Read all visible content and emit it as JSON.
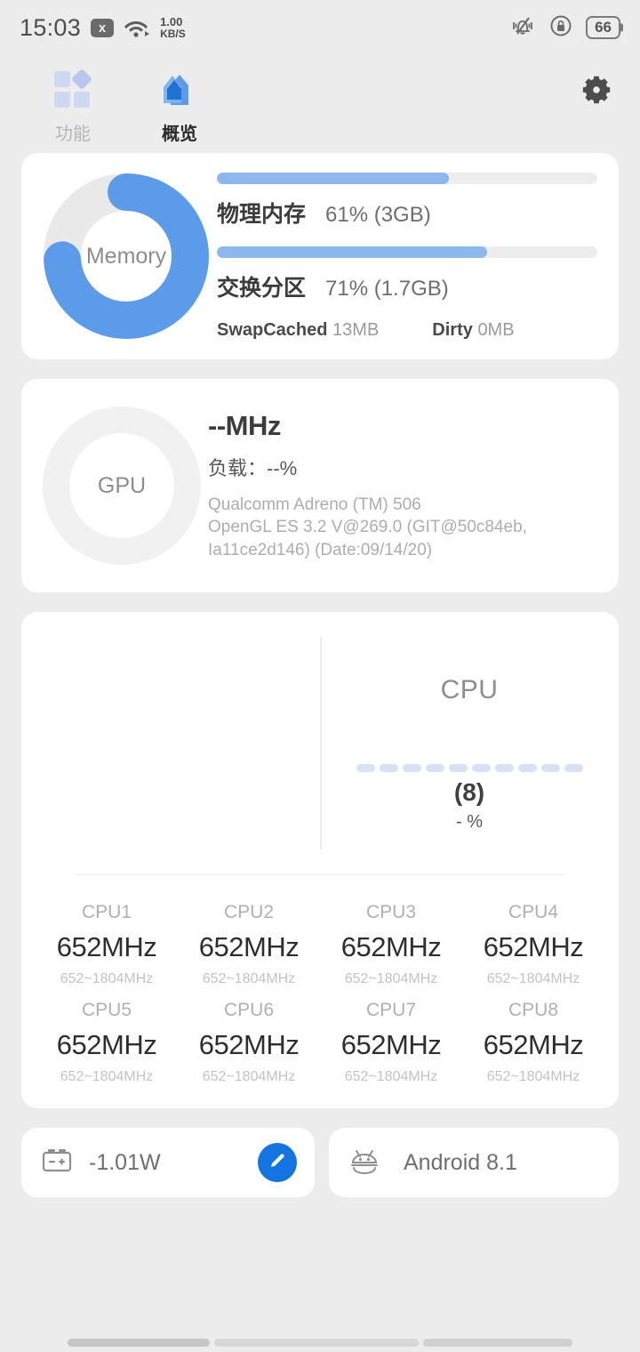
{
  "statusbar": {
    "time": "15:03",
    "xbox_badge": "x",
    "net_speed_value": "1.00",
    "net_speed_unit": "KB/S",
    "battery_percent": "66",
    "icons": [
      "wifi-icon",
      "mute-icon",
      "rotation-lock-icon",
      "battery-icon"
    ]
  },
  "tabs": [
    {
      "label": "功能",
      "icon": "apps-grid-icon",
      "active": false
    },
    {
      "label": "概览",
      "icon": "home-icon",
      "active": true
    }
  ],
  "settings_button": {
    "icon": "gear-icon",
    "label": ""
  },
  "memory_card": {
    "ring_label": "Memory",
    "ring_percent": 74,
    "rows": [
      {
        "name": "物理内存",
        "value": "61% (3GB)",
        "percent": 61
      },
      {
        "name": "交换分区",
        "value": "71% (1.7GB)",
        "percent": 71
      }
    ],
    "sub": [
      {
        "name": "SwapCached",
        "value": "13MB"
      },
      {
        "name": "Dirty",
        "value": "0MB"
      }
    ]
  },
  "gpu_card": {
    "ring_label": "GPU",
    "freq": "--MHz",
    "load": "负载：--%",
    "desc_line1": "Qualcomm Adreno (TM) 506",
    "desc_line2": "OpenGL ES 3.2 V@269.0 (GIT@50c84eb,",
    "desc_line3": "Ia11ce2d146) (Date:09/14/20)"
  },
  "cpu_card": {
    "title": "CPU",
    "count": "(8)",
    "percent": "- %",
    "dash_segments": 10,
    "cores": [
      {
        "name": "CPU1",
        "freq": "652MHz",
        "range": "652~1804MHz"
      },
      {
        "name": "CPU2",
        "freq": "652MHz",
        "range": "652~1804MHz"
      },
      {
        "name": "CPU3",
        "freq": "652MHz",
        "range": "652~1804MHz"
      },
      {
        "name": "CPU4",
        "freq": "652MHz",
        "range": "652~1804MHz"
      },
      {
        "name": "CPU5",
        "freq": "652MHz",
        "range": "652~1804MHz"
      },
      {
        "name": "CPU6",
        "freq": "652MHz",
        "range": "652~1804MHz"
      },
      {
        "name": "CPU7",
        "freq": "652MHz",
        "range": "652~1804MHz"
      },
      {
        "name": "CPU8",
        "freq": "652MHz",
        "range": "652~1804MHz"
      }
    ]
  },
  "bottom": {
    "power": {
      "icon": "battery-terminals-icon",
      "value": "-1.01W",
      "edit_icon": "pencil-icon"
    },
    "os": {
      "icon": "android-robot-icon",
      "value": "Android 8.1"
    }
  },
  "colors": {
    "accent_blue": "#5b9bea",
    "bar_blue": "#8cb8ee",
    "fab_blue": "#1475e0",
    "page_bg": "#ececec",
    "card_bg": "#ffffff",
    "muted_text": "#b0b0b0"
  }
}
